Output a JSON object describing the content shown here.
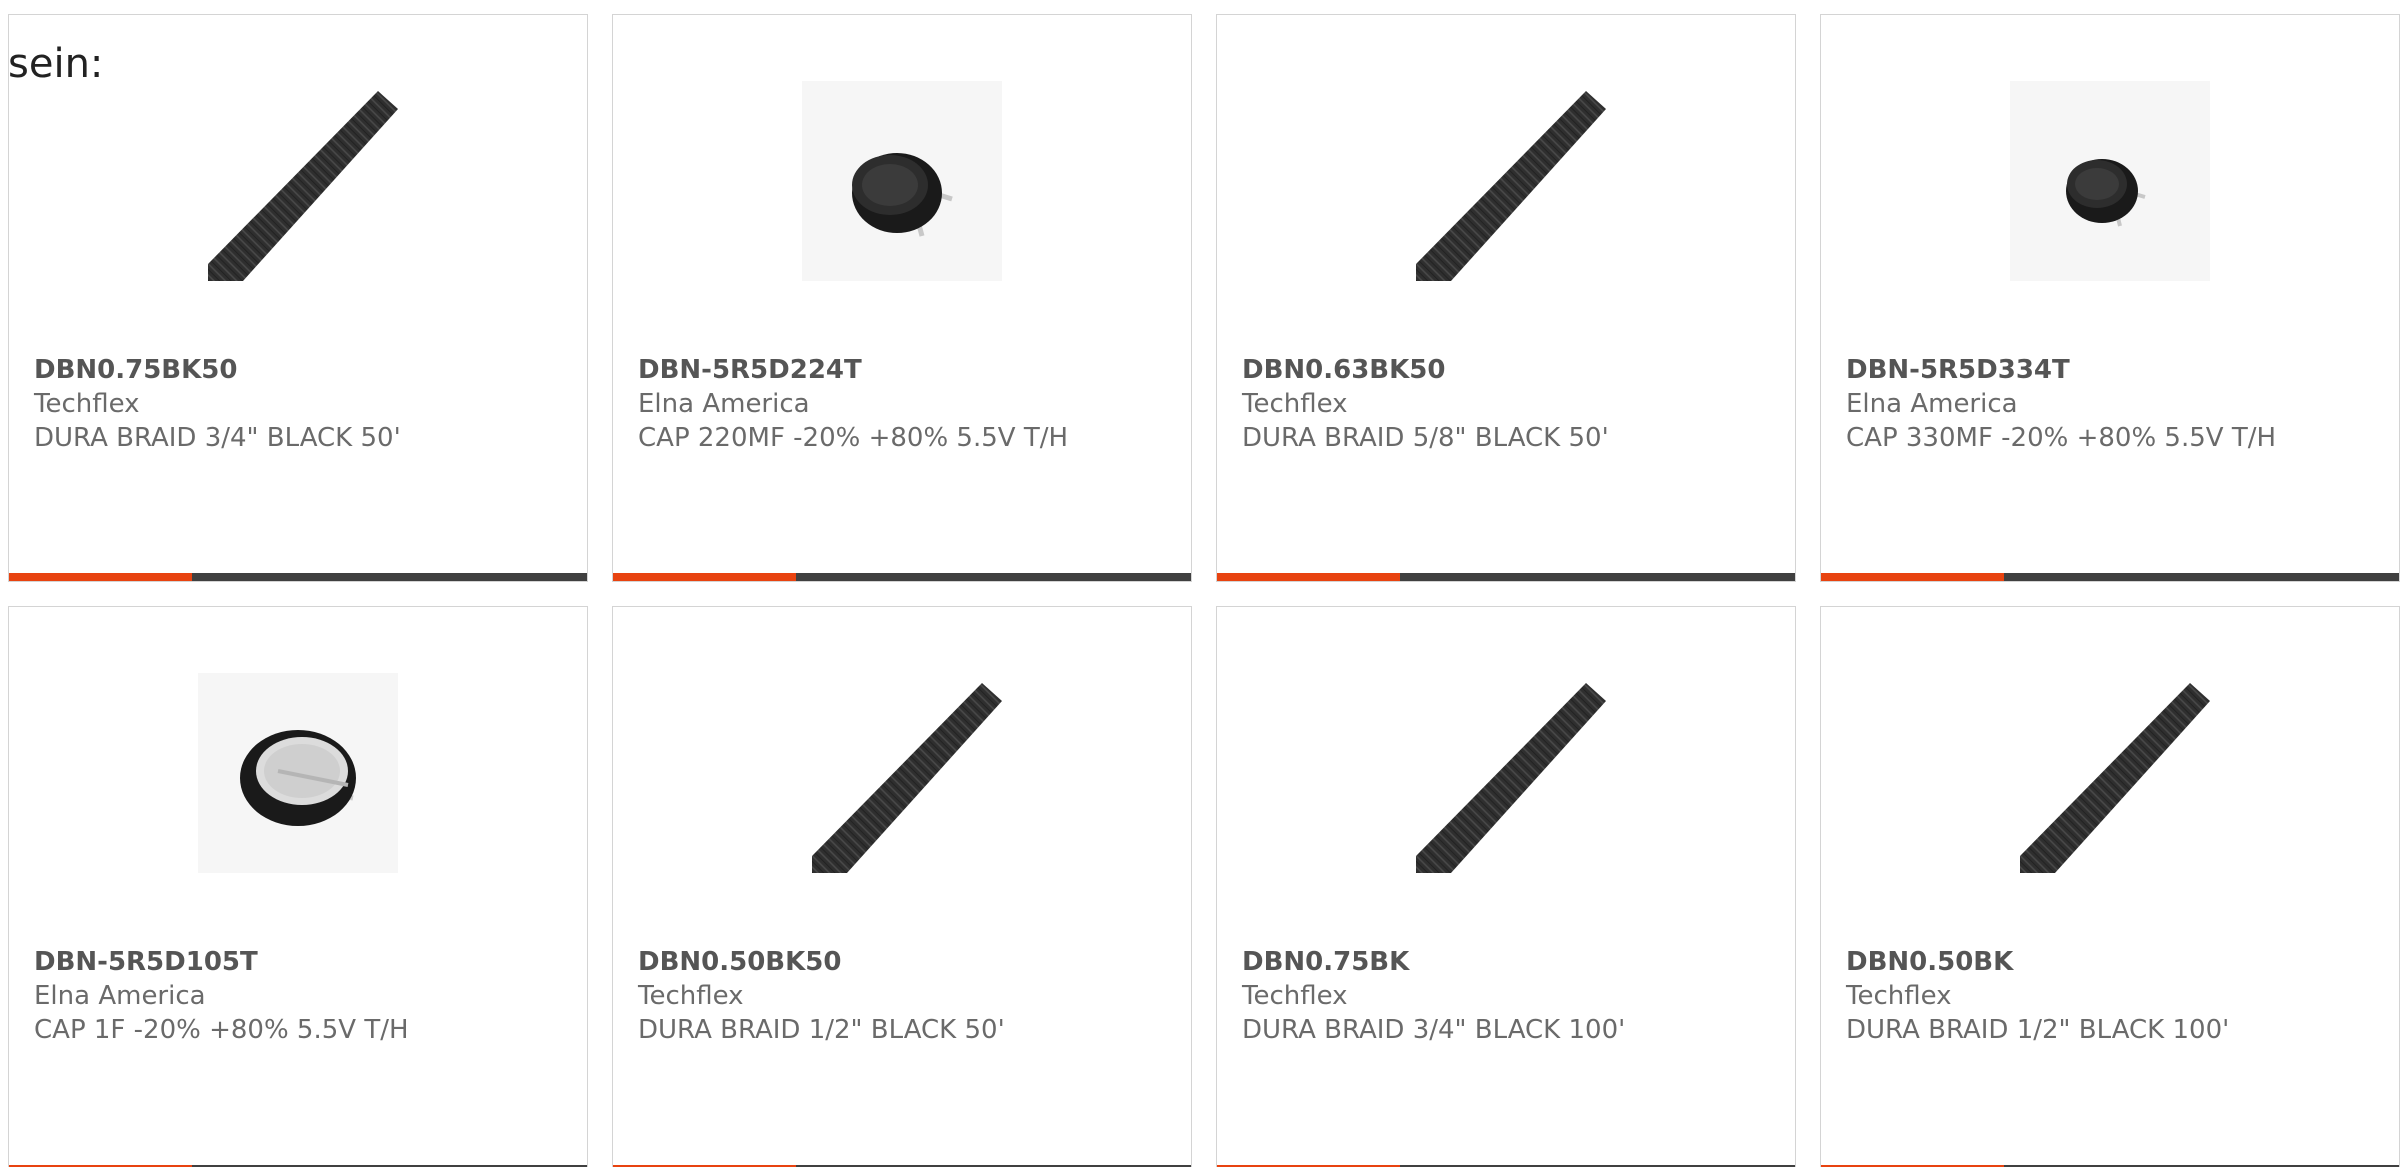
{
  "intro_text": "sein:",
  "colors": {
    "accent": "#e84310",
    "bar_dark": "#404040",
    "card_border": "#d4d4d4"
  },
  "products": [
    {
      "part": "DBN0.75BK50",
      "manufacturer": "Techflex",
      "description": "DURA BRAID 3/4\" BLACK 50'",
      "image": "braided-sleeving"
    },
    {
      "part": "DBN-5R5D224T",
      "manufacturer": "Elna America",
      "description": "CAP 220MF -20% +80% 5.5V T/H",
      "image": "coin-capacitor"
    },
    {
      "part": "DBN0.63BK50",
      "manufacturer": "Techflex",
      "description": "DURA BRAID 5/8\" BLACK 50'",
      "image": "braided-sleeving"
    },
    {
      "part": "DBN-5R5D334T",
      "manufacturer": "Elna America",
      "description": "CAP 330MF -20% +80% 5.5V T/H",
      "image": "coin-capacitor"
    },
    {
      "part": "DBN-5R5D105T",
      "manufacturer": "Elna America",
      "description": "CAP 1F -20% +80% 5.5V T/H",
      "image": "coin-capacitor"
    },
    {
      "part": "DBN0.50BK50",
      "manufacturer": "Techflex",
      "description": "DURA BRAID 1/2\" BLACK 50'",
      "image": "braided-sleeving"
    },
    {
      "part": "DBN0.75BK",
      "manufacturer": "Techflex",
      "description": "DURA BRAID 3/4\" BLACK 100'",
      "image": "braided-sleeving"
    },
    {
      "part": "DBN0.50BK",
      "manufacturer": "Techflex",
      "description": "DURA BRAID 1/2\" BLACK 100'",
      "image": "braided-sleeving"
    }
  ]
}
